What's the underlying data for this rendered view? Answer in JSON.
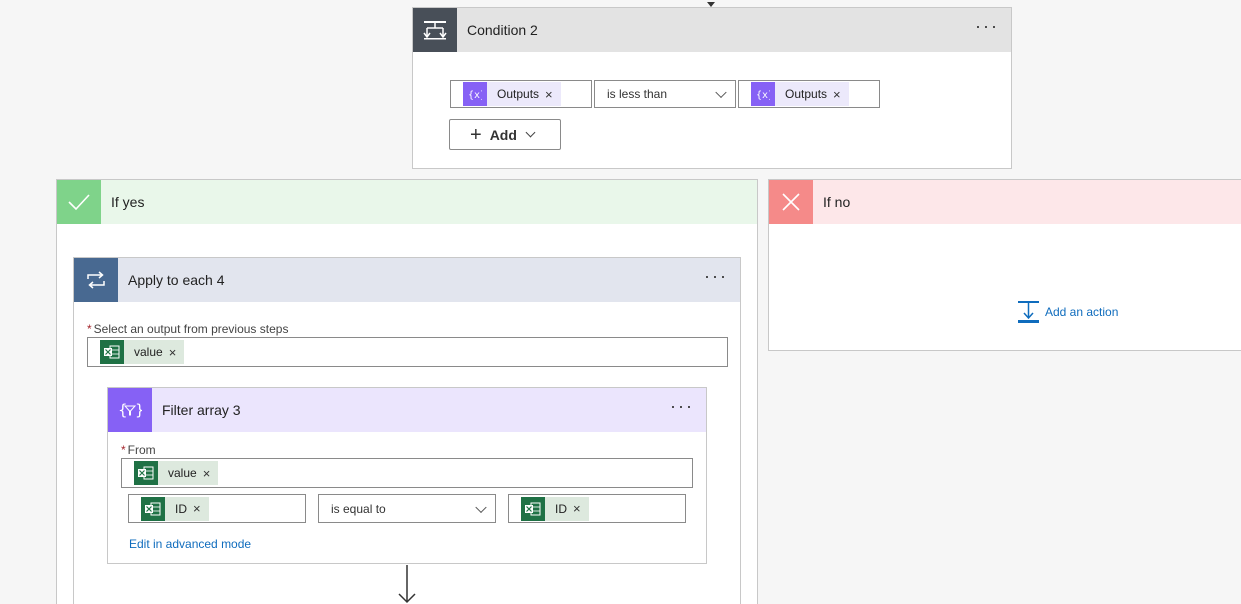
{
  "condition": {
    "title": "Condition 2",
    "left_token": "Outputs",
    "operator": "is less than",
    "right_token": "Outputs",
    "add_label": "Add"
  },
  "if_yes": {
    "title": "If yes"
  },
  "if_no": {
    "title": "If no",
    "add_action_label": "Add an action"
  },
  "apply_each": {
    "title": "Apply to each 4",
    "select_label": "Select an output from previous steps",
    "token": "value"
  },
  "filter": {
    "title": "Filter array 3",
    "from_label": "From",
    "from_token": "value",
    "left_token": "ID",
    "operator": "is equal to",
    "right_token": "ID",
    "advanced_link": "Edit in advanced mode"
  },
  "colors": {
    "condition_header": "#e3e3e3",
    "condition_icon": "#484f58",
    "yes_header": "#e9f7ea",
    "yes_icon": "#7fd38a",
    "no_header": "#fde7e9",
    "no_icon": "#f58a89",
    "apply_header": "#e2e5ee",
    "apply_icon": "#486991",
    "filter_header": "#ebe5fd",
    "filter_icon": "#8661f5",
    "link": "#0f6cbd"
  }
}
